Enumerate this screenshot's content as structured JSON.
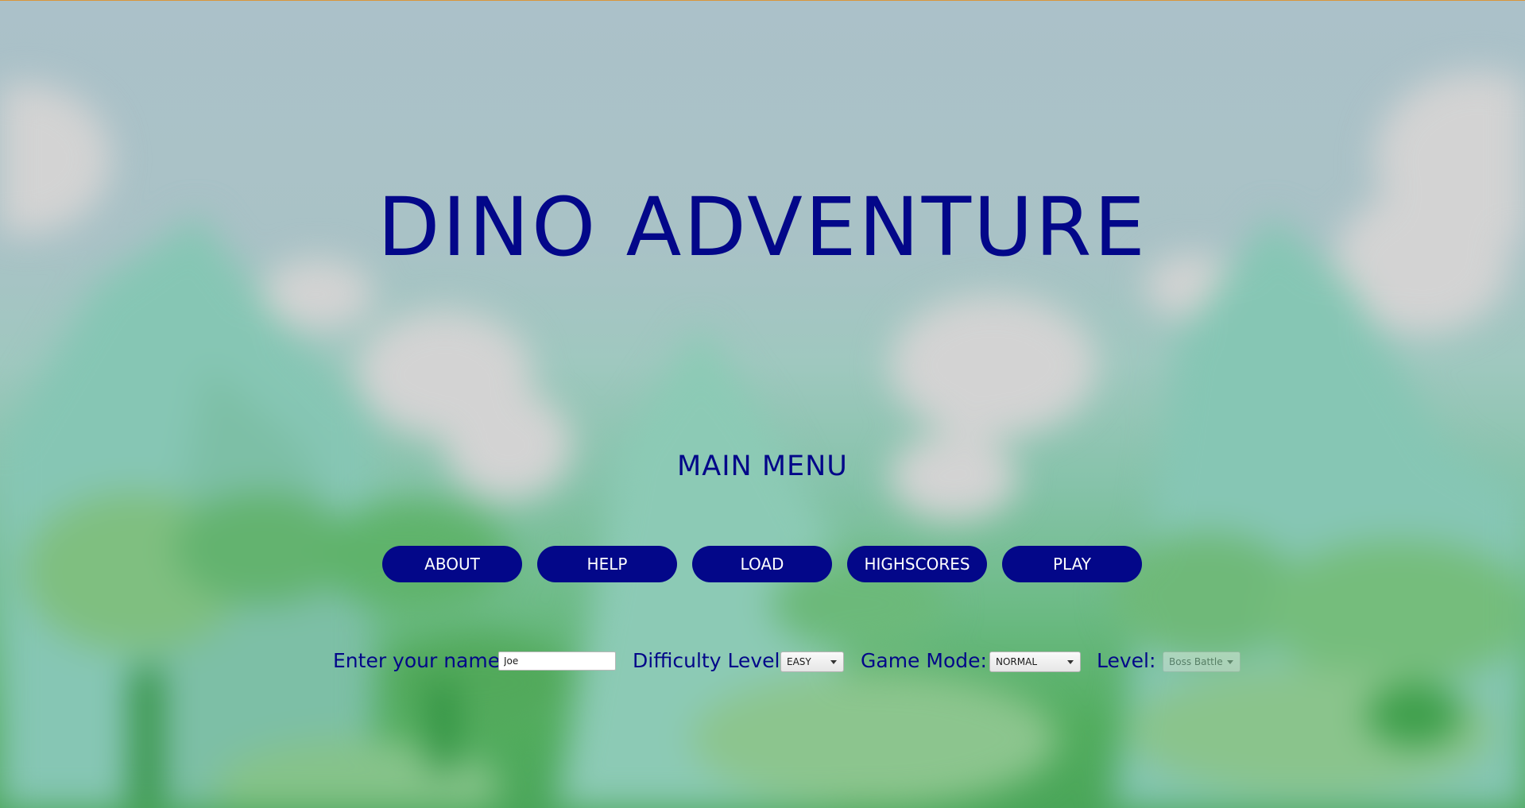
{
  "game": {
    "title": "DINO ADVENTURE",
    "subtitle": "MAIN MENU"
  },
  "menu": {
    "about": "ABOUT",
    "help": "HELP",
    "load": "LOAD",
    "highscores": "HIGHSCORES",
    "play": "PLAY"
  },
  "form": {
    "name_label": "Enter your name:",
    "name_value": "Joe",
    "difficulty_label": "Difficulty Level:",
    "difficulty_value": "EASY",
    "mode_label": "Game Mode:",
    "mode_value": "NORMAL",
    "level_label": "Level:",
    "level_value": "Boss Battle",
    "level_disabled": true
  },
  "colors": {
    "accent": "#030789",
    "button_text": "#ffffff",
    "top_border": "#d9953a"
  },
  "icons": {
    "dropdown": "chevron-down-icon"
  }
}
